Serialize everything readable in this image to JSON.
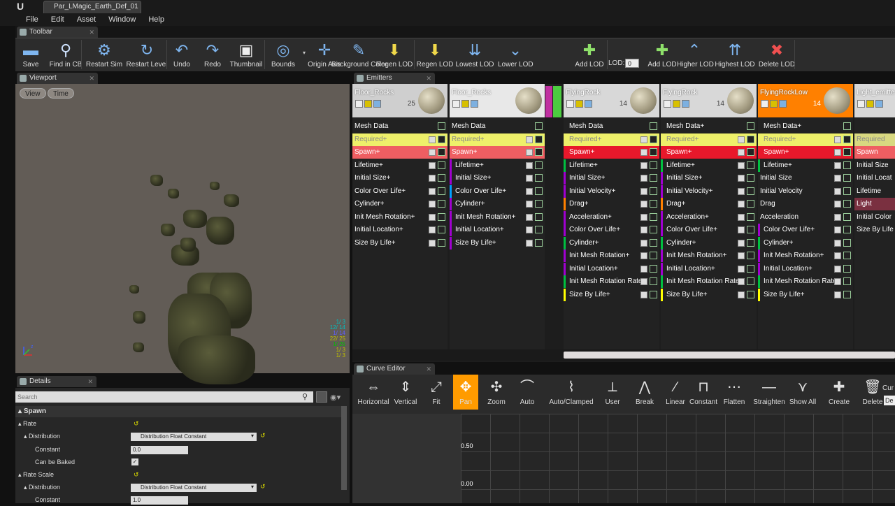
{
  "window": {
    "doc_tab": "Par_LMagic_Earth_Def_01"
  },
  "menu": [
    "File",
    "Edit",
    "Asset",
    "Window",
    "Help"
  ],
  "toolbar": {
    "tab": "Toolbar",
    "buttons": [
      {
        "name": "save-button",
        "label": "Save",
        "icon": "floppy-icon"
      },
      {
        "name": "find-in-cb-button",
        "label": "Find in CB",
        "icon": "magnifier-icon"
      },
      {
        "name": "restart-sim-button",
        "label": "Restart Sim",
        "icon": "gear-icon"
      },
      {
        "name": "restart-level-button",
        "label": "Restart Level",
        "icon": "refresh-icon"
      },
      {
        "name": "undo-button",
        "label": "Undo",
        "icon": "undo-icon"
      },
      {
        "name": "redo-button",
        "label": "Redo",
        "icon": "redo-icon"
      },
      {
        "name": "thumbnail-button",
        "label": "Thumbnail",
        "icon": "picture-icon"
      },
      {
        "name": "bounds-button",
        "label": "Bounds",
        "icon": "bounds-icon"
      },
      {
        "name": "origin-axis-button",
        "label": "Origin Axis",
        "icon": "axis-icon"
      },
      {
        "name": "background-color-button",
        "label": "Background Color",
        "icon": "brush-icon"
      },
      {
        "name": "regen-lod-button-1",
        "label": "Regen LOD",
        "icon": "regen-lod-icon"
      },
      {
        "name": "regen-lod-button-2",
        "label": "Regen LOD",
        "icon": "regen-lod-icon"
      },
      {
        "name": "lowest-lod-button",
        "label": "Lowest LOD",
        "icon": "lowest-lod-icon"
      },
      {
        "name": "lower-lod-button",
        "label": "Lower LOD",
        "icon": "lower-lod-icon"
      },
      {
        "name": "add-lod-button-1",
        "label": "Add LOD",
        "icon": "add-lod-icon"
      },
      {
        "name": "add-lod-button-2",
        "label": "Add LOD",
        "icon": "add-lod-icon"
      },
      {
        "name": "higher-lod-button",
        "label": "Higher LOD",
        "icon": "higher-lod-icon"
      },
      {
        "name": "highest-lod-button",
        "label": "Highest LOD",
        "icon": "highest-lod-icon"
      },
      {
        "name": "delete-lod-button",
        "label": "Delete LOD",
        "icon": "delete-icon"
      }
    ],
    "lod_label": "LOD:",
    "lod_value": "0"
  },
  "viewport": {
    "tab": "Viewport",
    "view_btn": "View",
    "time_btn": "Time",
    "stats": [
      "1/ 3",
      "12/ 14",
      "1/ 14",
      "22/ 25",
      "1/ 25",
      "1/ 3",
      "1/ 3"
    ]
  },
  "emitters": {
    "tab": "Emitters",
    "columns": [
      {
        "name": "Floor_Rocks",
        "count": "25",
        "modules": [
          "Mesh Data",
          "Required+",
          "Spawn+",
          "Lifetime+",
          "Initial Size+",
          "Color Over Life+",
          "Cylinder+",
          "Init Mesh Rotation+",
          "Initial Location+",
          "Size By Life+"
        ]
      },
      {
        "name": "Floor_Rocks",
        "count": "",
        "modules": [
          "Mesh Data",
          "Required+",
          "Spawn+",
          "Lifetime+",
          "Initial Size+",
          "Color Over Life+",
          "Cylinder+",
          "Init Mesh Rotation+",
          "Initial Location+",
          "Size By Life+"
        ]
      },
      {
        "name": "FlyingRock",
        "count": "14",
        "modules": [
          "Mesh Data",
          "Required+",
          "Spawn+",
          "Lifetime+",
          "Initial Size+",
          "Initial Velocity+",
          "Drag+",
          "Acceleration+",
          "Color Over Life+",
          "Cylinder+",
          "Init Mesh Rotation+",
          "Initial Location+",
          "Init Mesh Rotation Rate+",
          "Size By Life+"
        ]
      },
      {
        "name": "FlyingRock",
        "count": "14",
        "modules": [
          "Mesh Data+",
          "Required+",
          "Spawn+",
          "Lifetime+",
          "Initial Size+",
          "Initial Velocity+",
          "Drag+",
          "Acceleration+",
          "Color Over Life+",
          "Cylinder+",
          "Init Mesh Rotation+",
          "Initial Location+",
          "Init Mesh Rotation Rate+",
          "Size By Life+"
        ]
      },
      {
        "name": "FlyingRockLow",
        "count": "14",
        "modules": [
          "Mesh Data+",
          "Required+",
          "Spawn+",
          "Lifetime+",
          "Initial Size",
          "Initial Velocity",
          "Drag",
          "Acceleration",
          "Color Over Life+",
          "Cylinder+",
          "Init Mesh Rotation+",
          "Initial Location+",
          "Init Mesh Rotation Rate+",
          "Size By Life+"
        ]
      },
      {
        "name": "Light_emitte",
        "count": "",
        "modules": [
          "",
          "Required",
          "Spawn",
          "Initial Size",
          "Initial Locat",
          "Lifetime",
          "Light",
          "Initial Color",
          "Size By Life"
        ]
      }
    ]
  },
  "details": {
    "tab": "Details",
    "search_placeholder": "Search",
    "section": "Spawn",
    "rows": {
      "rate": "Rate",
      "distribution": "Distribution",
      "dist_value": "Distribution Float Constant",
      "constant": "Constant",
      "constant_value": "0.0",
      "can_be_baked": "Can be Baked",
      "rate_scale": "Rate Scale",
      "distribution2": "Distribution",
      "dist_value2": "Distribution Float Constant",
      "constant2": "Constant",
      "constant_value2": "1.0"
    }
  },
  "curve_editor": {
    "tab": "Curve Editor",
    "buttons": [
      {
        "name": "horizontal-button",
        "label": "Horizontal",
        "icon": "horizontal-fit-icon"
      },
      {
        "name": "vertical-button",
        "label": "Vertical",
        "icon": "vertical-fit-icon"
      },
      {
        "name": "fit-button",
        "label": "Fit",
        "icon": "fit-icon"
      },
      {
        "name": "pan-button",
        "label": "Pan",
        "icon": "pan-icon"
      },
      {
        "name": "zoom-button",
        "label": "Zoom",
        "icon": "zoom-icon"
      },
      {
        "name": "auto-button",
        "label": "Auto",
        "icon": "auto-tangent-icon"
      },
      {
        "name": "auto-clamped-button",
        "label": "Auto/Clamped",
        "icon": "auto-clamped-icon"
      },
      {
        "name": "user-button",
        "label": "User",
        "icon": "user-tangent-icon"
      },
      {
        "name": "break-button",
        "label": "Break",
        "icon": "break-icon"
      },
      {
        "name": "linear-button",
        "label": "Linear",
        "icon": "linear-icon"
      },
      {
        "name": "constant-button",
        "label": "Constant",
        "icon": "constant-icon"
      },
      {
        "name": "flatten-button",
        "label": "Flatten",
        "icon": "flatten-icon"
      },
      {
        "name": "straighten-button",
        "label": "Straighten",
        "icon": "straighten-icon"
      },
      {
        "name": "show-all-button",
        "label": "Show All",
        "icon": "show-all-icon"
      },
      {
        "name": "create-button",
        "label": "Create",
        "icon": "create-icon"
      },
      {
        "name": "delete-button",
        "label": "Delete",
        "icon": "trash-icon"
      }
    ],
    "cut_label": "Cur",
    "cut_value": "De",
    "y_labels": [
      "0.50",
      "0.00"
    ]
  },
  "colors": {
    "accent": "#ff9b00",
    "required": "#eff06a",
    "spawn": "#ef5e62",
    "spawn_selected": "#e8182b",
    "selected_head": "#ff8000"
  }
}
